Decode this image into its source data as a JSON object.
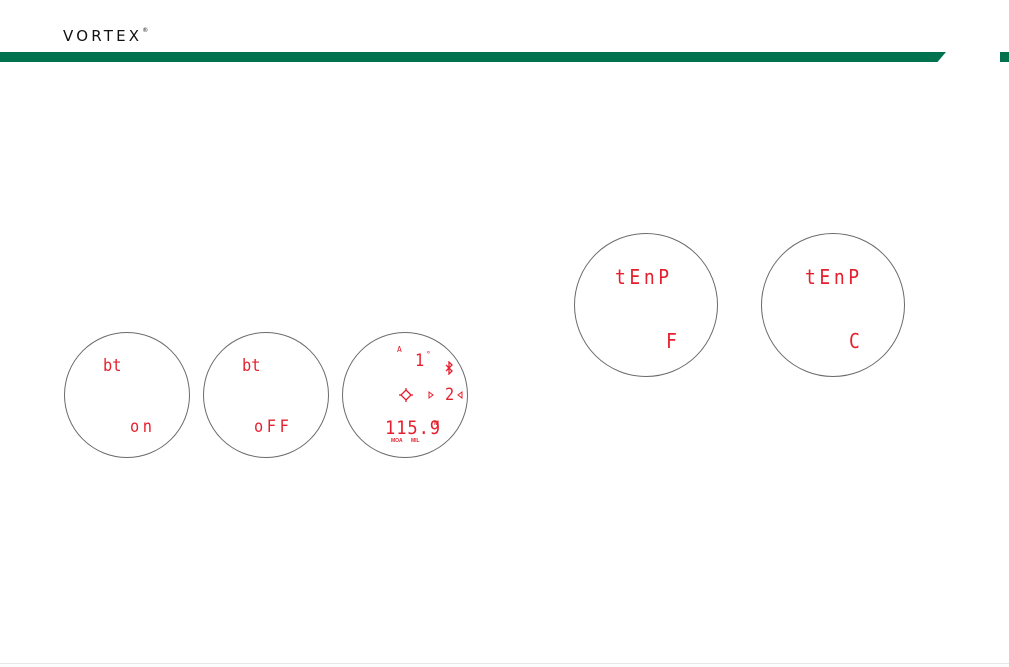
{
  "header": {
    "brand": "VORTEX",
    "brand_mark": "®"
  },
  "colors": {
    "band": "#00734e",
    "display": "#e4202e",
    "outline": "#6b6b6b"
  },
  "displays": {
    "bt_on": {
      "top": "bt",
      "bottom": "on"
    },
    "bt_off": {
      "top": "bt",
      "bottom": "oFF"
    },
    "ranging": {
      "angle_marker": "A",
      "angle_value": "1",
      "degree": "°",
      "reticle_icon": "crosshair-icon",
      "bluetooth_icon": "bluetooth-icon",
      "hold_value": "2",
      "distance": "115.9",
      "unit": "M",
      "label_moa": "MOA",
      "label_mil": "MIL"
    },
    "temp_f": {
      "top": "tEnP",
      "bottom": "F"
    },
    "temp_c": {
      "top": "tEnP",
      "bottom": "C"
    }
  }
}
